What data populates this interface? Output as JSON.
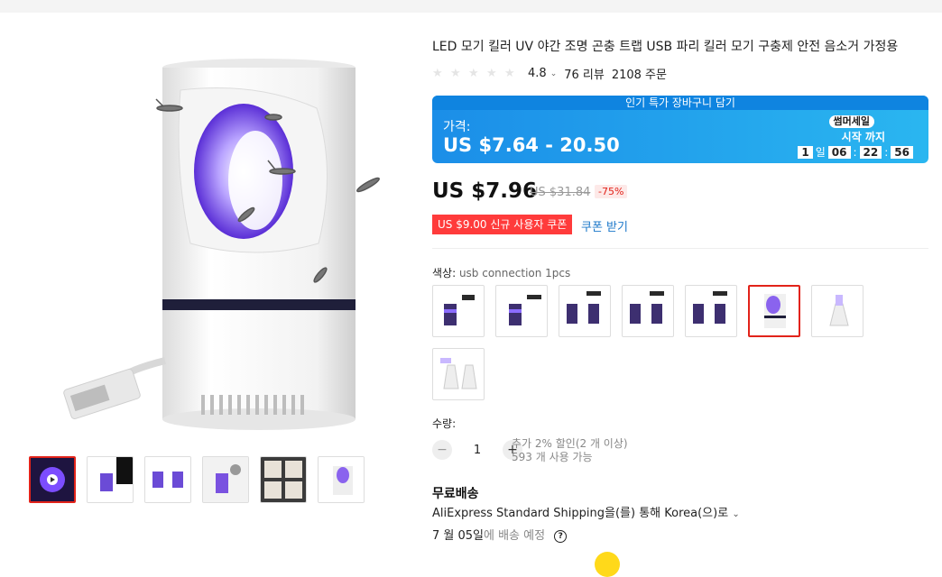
{
  "product": {
    "title": "LED 모기 킬러 UV 야간 조명 곤충 트랩 USB 파리 킬러 모기 구충제 안전 음소거 가정용",
    "rating": "4.8",
    "reviews": "76 리뷰",
    "orders": "2108 주문"
  },
  "banner": {
    "top_text": "인기 특가 장바구니 담기",
    "label": "가격:",
    "price_range": "US $7.64 - 20.50",
    "sale_badge": "썸머세일",
    "starts_until": "시작 까지",
    "countdown": {
      "days": "1",
      "day_label": "일",
      "hours": "06",
      "minutes": "22",
      "seconds": "56",
      "sep": ":"
    }
  },
  "price": {
    "current": "US $7.96",
    "original": "US $31.84",
    "discount": "-75%"
  },
  "coupon": {
    "badge": "US $9.00 신규 사용자 쿠폰",
    "link": "쿠폰 받기"
  },
  "color": {
    "label": "색상:",
    "selected": "usb connection 1pcs"
  },
  "quantity": {
    "label": "수량:",
    "minus": "−",
    "value": "1",
    "plus": "+",
    "note1": "추가 2% 할인(2 개 이상)",
    "note2": "593 개 사용 가능"
  },
  "shipping": {
    "title": "무료배송",
    "method": "AliExpress Standard Shipping을(를) 통해 Korea(으)로",
    "date": "7 월 05일",
    "date_suffix": "에 배송 예정",
    "help": "?"
  },
  "colors": {
    "accent": "#e2231a",
    "banner": "#1b8ee8",
    "link": "#1a77c9"
  }
}
